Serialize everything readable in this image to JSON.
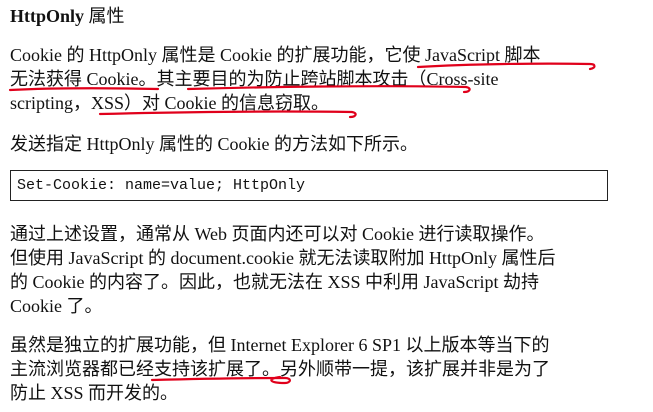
{
  "heading": {
    "latin": "HttpOnly",
    "cjk": " 属性"
  },
  "paragraph1": {
    "line1": "Cookie 的 HttpOnly 属性是 Cookie 的扩展功能，它使 JavaScript 脚本",
    "line2": "无法获得 Cookie。其主要目的为防止跨站脚本攻击（Cross-site",
    "line3": "scripting，XSS）对 Cookie 的信息窃取。"
  },
  "paragraph2": {
    "line1": "发送指定 HttpOnly 属性的 Cookie 的方法如下所示。"
  },
  "code": {
    "text": "Set-Cookie: name=value; HttpOnly"
  },
  "paragraph3": {
    "line1": "通过上述设置，通常从 Web 页面内还可以对 Cookie 进行读取操作。",
    "line2": "但使用 JavaScript 的 document.cookie 就无法读取附加 HttpOnly 属性后",
    "line3": "的 Cookie 的内容了。因此，也就无法在 XSS 中利用 JavaScript 劫持",
    "line4": "Cookie 了。"
  },
  "paragraph4": {
    "line1": "虽然是独立的扩展功能，但 Internet Explorer 6 SP1 以上版本等当下的",
    "line2": "主流浏览器都已经支持该扩展了。另外顺带一提，该扩展并非是为了",
    "line3": "防止 XSS 而开发的。"
  },
  "colors": {
    "text": "#111111",
    "annotation": "#e0001b",
    "background": "#ffffff",
    "code_border": "#222222"
  }
}
